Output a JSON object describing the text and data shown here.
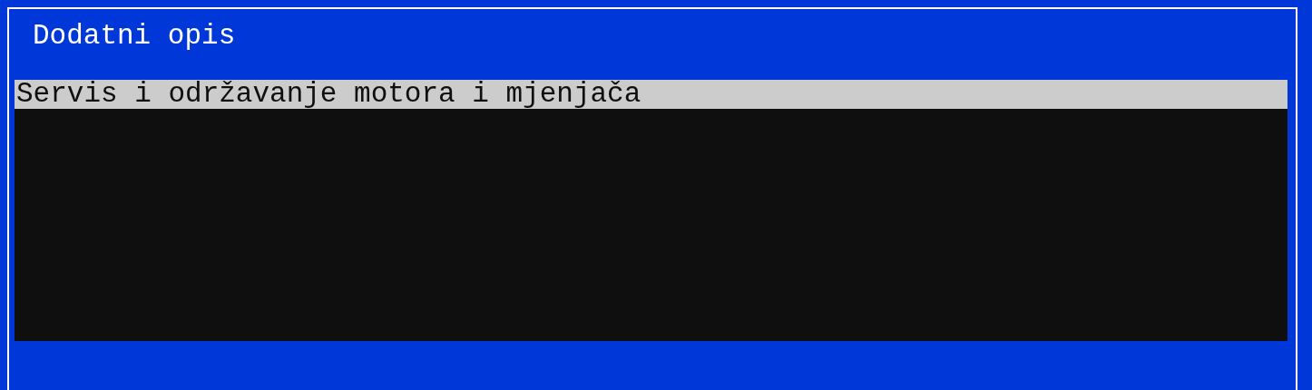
{
  "dialog": {
    "title": "Dodatni opis"
  },
  "text_area": {
    "lines": [
      {
        "text": "Servis i održavanje motora i mjenjača",
        "selected": true
      }
    ]
  }
}
